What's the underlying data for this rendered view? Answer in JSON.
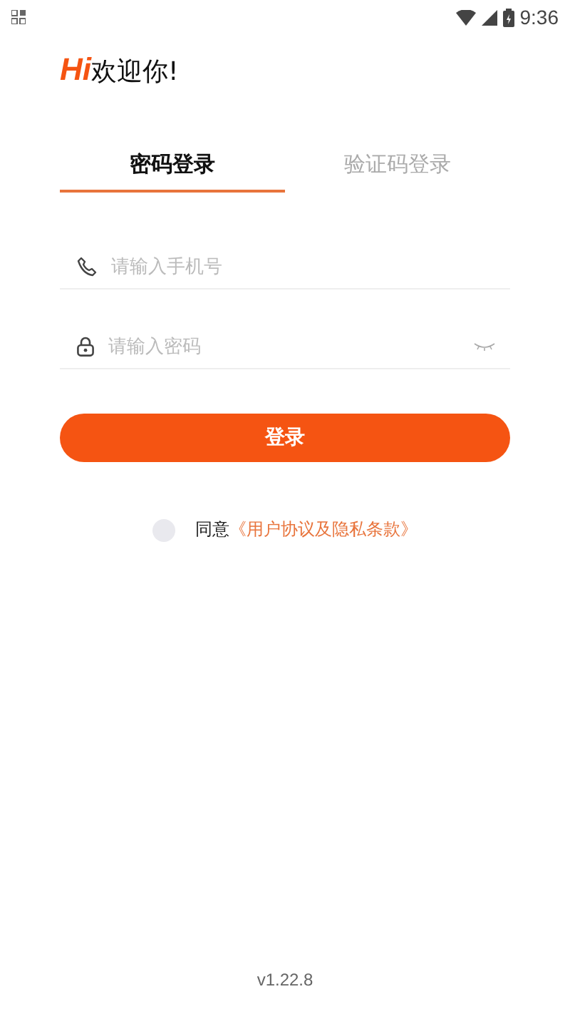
{
  "status_bar": {
    "time": "9:36"
  },
  "header": {
    "hi": "Hi",
    "greeting": "欢迎你!"
  },
  "tabs": [
    {
      "label": "密码登录",
      "selected": true
    },
    {
      "label": "验证码登录",
      "selected": false
    }
  ],
  "fields": [
    {
      "kind": "phone",
      "placeholder": "请输入手机号"
    },
    {
      "kind": "password",
      "placeholder": "请输入密码"
    }
  ],
  "login_button": "登录",
  "agreement": {
    "checked": false,
    "text": "同意",
    "link": "《用户协议及隐私条款》"
  },
  "version": "v1.22.8"
}
